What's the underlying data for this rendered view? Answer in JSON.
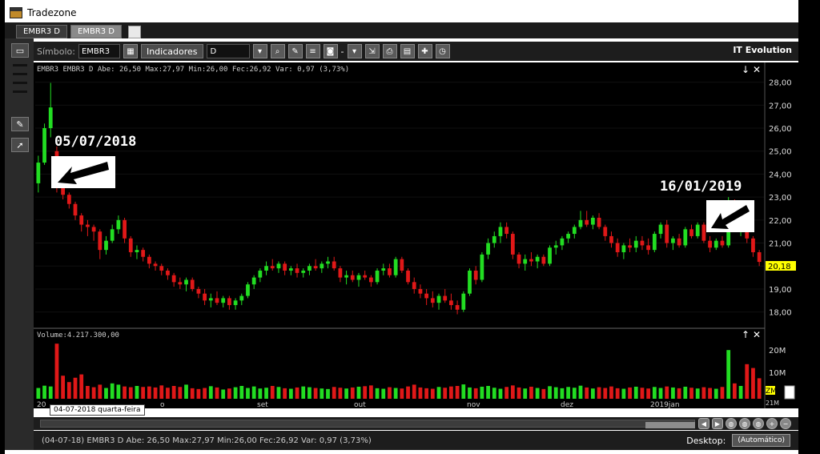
{
  "window": {
    "title": "Tradezone"
  },
  "tabs": [
    {
      "label": "EMBR3 D"
    },
    {
      "label": "EMBR3 D"
    }
  ],
  "toolbar": {
    "symbol_label": "Símbolo:",
    "symbol_value": "EMBR3",
    "indicators_label": "Indicadores",
    "period_value": "D",
    "dash": "-",
    "brand": "IT Evolution"
  },
  "chart_info": {
    "ohlc_line": "EMBR3 EMBR3 D  Abe: 26,50  Max:27,97  Min:26,00  Fec:26,92  Var: 0,97 (3,73%)",
    "volume_line": "Volume:4.217.300,00",
    "current_price": "20,18",
    "tooltip": "04-07-2018 quarta-feira",
    "price_axis": [
      "28,00",
      "27,00",
      "26,00",
      "25,00",
      "24,00",
      "23,00",
      "22,00",
      "21,00",
      "20,00",
      "19,00",
      "18,00"
    ],
    "volume_axis": [
      "20M",
      "10M"
    ],
    "volume_axis_small": "ZM",
    "volume_axis_tiny": "21M",
    "x_axis_visible": [
      "set",
      "out",
      "nov",
      "dez",
      "2019jan"
    ],
    "x_axis_partial_start": "20",
    "x_axis_partial_mid": "o",
    "panel_controls": {
      "down_arrow": "↓",
      "up_arrow": "↑",
      "close": "✕"
    }
  },
  "annotations": [
    {
      "text": "05/07/2018"
    },
    {
      "text": "16/01/2019"
    }
  ],
  "colors": {
    "up": "#22dd22",
    "down": "#e01818",
    "background": "#000000",
    "accent": "#ffff00"
  },
  "chart_data": {
    "type": "candlestick",
    "title": "",
    "series_label": "EMBR3 D",
    "y_range": [
      17.5,
      28.3
    ],
    "candles": [
      [
        23.6,
        24.8,
        23.2,
        24.5
      ],
      [
        24.5,
        26.2,
        24.4,
        26.0
      ],
      [
        26.0,
        27.97,
        25.6,
        26.9
      ],
      [
        25.0,
        25.2,
        23.2,
        23.4
      ],
      [
        23.4,
        23.6,
        22.9,
        23.1
      ],
      [
        23.1,
        23.2,
        22.5,
        22.7
      ],
      [
        22.7,
        22.8,
        22.0,
        22.2
      ],
      [
        22.2,
        22.3,
        21.5,
        21.8
      ],
      [
        21.8,
        22.0,
        21.3,
        21.7
      ],
      [
        21.7,
        21.8,
        21.1,
        21.5
      ],
      [
        21.5,
        21.6,
        20.3,
        20.7
      ],
      [
        20.7,
        21.3,
        20.5,
        21.1
      ],
      [
        21.1,
        21.8,
        21.0,
        21.6
      ],
      [
        21.6,
        22.2,
        21.4,
        22.0
      ],
      [
        22.0,
        22.1,
        21.0,
        21.2
      ],
      [
        21.2,
        21.3,
        20.4,
        20.6
      ],
      [
        20.6,
        20.9,
        20.3,
        20.7
      ],
      [
        20.7,
        20.8,
        20.2,
        20.4
      ],
      [
        20.4,
        20.5,
        19.9,
        20.1
      ],
      [
        20.1,
        20.2,
        19.8,
        20.0
      ],
      [
        20.0,
        20.1,
        19.6,
        19.8
      ],
      [
        19.8,
        19.9,
        19.4,
        19.6
      ],
      [
        19.6,
        19.7,
        19.1,
        19.3
      ],
      [
        19.3,
        19.5,
        19.0,
        19.2
      ],
      [
        19.2,
        19.5,
        18.9,
        19.4
      ],
      [
        19.4,
        19.5,
        18.9,
        19.0
      ],
      [
        19.0,
        19.1,
        18.6,
        18.8
      ],
      [
        18.8,
        19.0,
        18.3,
        18.5
      ],
      [
        18.5,
        18.8,
        18.2,
        18.6
      ],
      [
        18.6,
        18.9,
        18.3,
        18.4
      ],
      [
        18.4,
        18.7,
        18.2,
        18.6
      ],
      [
        18.6,
        18.7,
        18.1,
        18.3
      ],
      [
        18.3,
        18.6,
        18.1,
        18.5
      ],
      [
        18.5,
        18.8,
        18.3,
        18.7
      ],
      [
        18.7,
        19.3,
        18.6,
        19.2
      ],
      [
        19.2,
        19.6,
        19.0,
        19.5
      ],
      [
        19.5,
        19.9,
        19.3,
        19.8
      ],
      [
        19.8,
        20.2,
        19.6,
        20.0
      ],
      [
        20.0,
        20.3,
        19.8,
        19.9
      ],
      [
        19.9,
        20.2,
        19.7,
        20.1
      ],
      [
        20.1,
        20.2,
        19.6,
        19.8
      ],
      [
        19.8,
        20.0,
        19.6,
        19.9
      ],
      [
        19.9,
        20.1,
        19.5,
        19.7
      ],
      [
        19.7,
        19.9,
        19.5,
        19.8
      ],
      [
        19.8,
        20.1,
        19.6,
        20.0
      ],
      [
        20.0,
        20.3,
        19.8,
        19.9
      ],
      [
        19.9,
        20.2,
        19.7,
        20.1
      ],
      [
        20.1,
        20.4,
        19.9,
        20.2
      ],
      [
        20.2,
        20.4,
        19.8,
        19.9
      ],
      [
        19.9,
        20.0,
        19.3,
        19.5
      ],
      [
        19.5,
        19.8,
        19.2,
        19.6
      ],
      [
        19.6,
        19.8,
        19.3,
        19.4
      ],
      [
        19.4,
        19.7,
        19.1,
        19.6
      ],
      [
        19.6,
        19.8,
        19.4,
        19.5
      ],
      [
        19.5,
        19.6,
        19.1,
        19.3
      ],
      [
        19.3,
        19.9,
        19.2,
        19.8
      ],
      [
        19.8,
        20.1,
        19.6,
        19.9
      ],
      [
        19.9,
        20.1,
        19.5,
        19.6
      ],
      [
        19.6,
        20.4,
        19.5,
        20.3
      ],
      [
        20.3,
        20.4,
        19.7,
        19.8
      ],
      [
        19.8,
        19.9,
        19.2,
        19.3
      ],
      [
        19.3,
        19.5,
        18.8,
        19.0
      ],
      [
        19.0,
        19.2,
        18.6,
        18.8
      ],
      [
        18.8,
        19.0,
        18.3,
        18.6
      ],
      [
        18.6,
        18.9,
        18.2,
        18.4
      ],
      [
        18.4,
        18.8,
        18.1,
        18.7
      ],
      [
        18.7,
        19.0,
        18.4,
        18.5
      ],
      [
        18.5,
        18.8,
        18.1,
        18.3
      ],
      [
        18.3,
        18.5,
        17.9,
        18.1
      ],
      [
        18.1,
        18.9,
        18.0,
        18.8
      ],
      [
        18.8,
        19.9,
        18.7,
        19.8
      ],
      [
        19.8,
        20.0,
        19.2,
        19.4
      ],
      [
        19.4,
        20.6,
        19.3,
        20.5
      ],
      [
        20.5,
        21.2,
        20.3,
        21.0
      ],
      [
        21.0,
        21.5,
        20.8,
        21.3
      ],
      [
        21.3,
        21.9,
        21.0,
        21.7
      ],
      [
        21.7,
        21.9,
        21.2,
        21.4
      ],
      [
        21.4,
        21.5,
        20.3,
        20.5
      ],
      [
        20.5,
        20.6,
        19.9,
        20.1
      ],
      [
        20.1,
        20.5,
        19.8,
        20.3
      ],
      [
        20.3,
        20.6,
        20.0,
        20.2
      ],
      [
        20.2,
        20.5,
        19.9,
        20.4
      ],
      [
        20.4,
        20.5,
        20.0,
        20.1
      ],
      [
        20.1,
        20.9,
        20.0,
        20.8
      ],
      [
        20.8,
        21.1,
        20.5,
        20.9
      ],
      [
        20.9,
        21.3,
        20.7,
        21.2
      ],
      [
        21.2,
        21.5,
        21.0,
        21.4
      ],
      [
        21.4,
        21.8,
        21.2,
        21.7
      ],
      [
        21.7,
        22.4,
        21.6,
        22.0
      ],
      [
        22.0,
        22.4,
        21.7,
        21.8
      ],
      [
        21.8,
        22.2,
        21.6,
        22.1
      ],
      [
        22.1,
        22.3,
        21.6,
        21.7
      ],
      [
        21.7,
        21.8,
        21.1,
        21.3
      ],
      [
        21.3,
        21.5,
        20.8,
        21.0
      ],
      [
        21.0,
        21.2,
        20.4,
        20.6
      ],
      [
        20.6,
        21.0,
        20.3,
        20.9
      ],
      [
        20.9,
        21.2,
        20.6,
        20.8
      ],
      [
        20.8,
        21.3,
        20.6,
        21.1
      ],
      [
        21.1,
        21.3,
        20.7,
        20.9
      ],
      [
        20.9,
        21.2,
        20.5,
        20.7
      ],
      [
        20.7,
        21.5,
        20.6,
        21.4
      ],
      [
        21.4,
        21.9,
        21.2,
        21.8
      ],
      [
        21.8,
        22.0,
        20.8,
        21.0
      ],
      [
        21.0,
        21.3,
        20.7,
        21.2
      ],
      [
        21.2,
        21.4,
        20.8,
        20.9
      ],
      [
        20.9,
        21.7,
        20.8,
        21.6
      ],
      [
        21.6,
        21.8,
        21.2,
        21.3
      ],
      [
        21.3,
        21.9,
        21.2,
        21.8
      ],
      [
        21.8,
        21.9,
        21.0,
        21.1
      ],
      [
        21.1,
        21.3,
        20.6,
        20.8
      ],
      [
        20.8,
        21.2,
        20.7,
        21.1
      ],
      [
        21.1,
        21.3,
        20.8,
        20.9
      ],
      [
        20.9,
        23.0,
        20.8,
        22.8
      ],
      [
        22.8,
        22.9,
        21.5,
        21.6
      ],
      [
        21.6,
        21.8,
        21.3,
        21.7
      ],
      [
        21.7,
        21.8,
        21.0,
        21.2
      ],
      [
        21.2,
        21.3,
        20.4,
        20.6
      ],
      [
        20.6,
        20.7,
        20.0,
        20.18
      ]
    ],
    "volume_millions": [
      4.2,
      5.1,
      4.8,
      21.5,
      9.0,
      6.5,
      8.2,
      9.5,
      5.0,
      4.5,
      5.5,
      4.2,
      6.0,
      5.5,
      4.8,
      4.5,
      5.0,
      4.6,
      4.8,
      4.4,
      5.2,
      4.3,
      5.0,
      4.6,
      5.5,
      4.1,
      3.8,
      4.2,
      4.9,
      4.4,
      3.6,
      4.0,
      4.5,
      5.0,
      4.2,
      4.8,
      4.0,
      4.3,
      5.0,
      4.6,
      4.1,
      3.9,
      4.4,
      4.8,
      4.5,
      4.2,
      4.0,
      3.8,
      4.6,
      4.3,
      4.0,
      4.4,
      4.7,
      4.9,
      5.2,
      4.1,
      3.9,
      4.5,
      4.2,
      4.0,
      4.8,
      5.5,
      4.4,
      4.1,
      3.9,
      4.6,
      4.3,
      4.8,
      5.0,
      5.6,
      4.4,
      4.1,
      4.7,
      5.0,
      4.3,
      3.9,
      4.6,
      5.2,
      4.4,
      4.0,
      4.7,
      4.2,
      3.8,
      4.9,
      4.5,
      4.1,
      4.6,
      4.3,
      5.1,
      4.4,
      4.0,
      4.5,
      4.2,
      4.8,
      4.1,
      3.9,
      4.4,
      4.7,
      4.3,
      4.0,
      4.6,
      4.2,
      4.8,
      4.4,
      4.1,
      4.7,
      4.3,
      4.0,
      4.5,
      4.2,
      3.9,
      4.6,
      19.0,
      6.0,
      5.0,
      13.5,
      12.0,
      8.0
    ]
  }
}
